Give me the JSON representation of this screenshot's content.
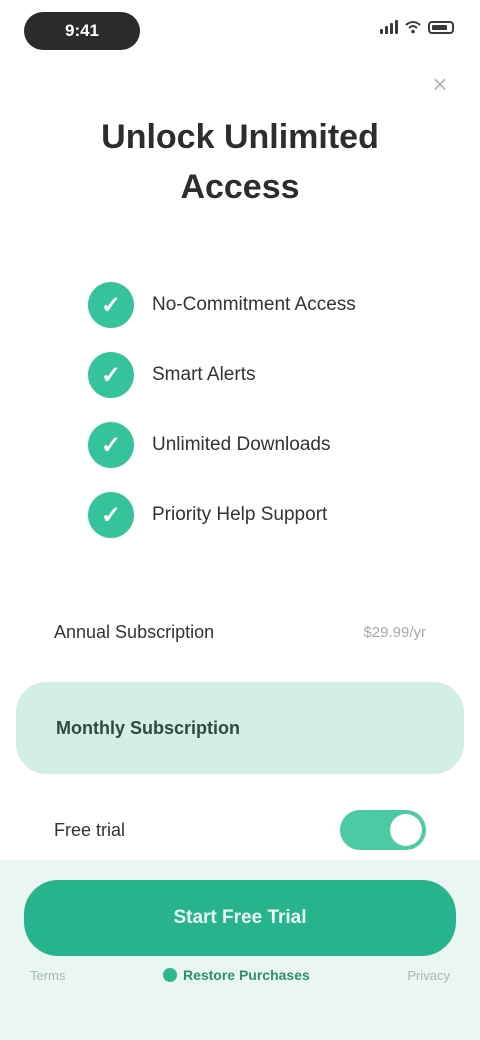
{
  "status_bar": {
    "time": "9:41"
  },
  "close_glyph": "×",
  "title": "Unlock Unlimited Access",
  "features": [
    {
      "icon": "check-icon",
      "label": "No-Commitment Access"
    },
    {
      "icon": "check-icon",
      "label": "Smart Alerts"
    },
    {
      "icon": "check-icon",
      "label": "Unlimited Downloads"
    },
    {
      "icon": "check-icon",
      "label": "Priority Help Support"
    }
  ],
  "plans": {
    "annual": {
      "label": "Annual Subscription",
      "price": "$29.99/yr"
    },
    "monthly": {
      "label": "Monthly Subscription"
    },
    "trial": {
      "label": "Free trial",
      "toggle_on": true
    }
  },
  "cta": {
    "label": "Start Free Trial"
  },
  "footer": {
    "left": "Terms",
    "center": "Restore Purchases",
    "right": "Privacy"
  },
  "colors": {
    "accent": "#27b48c",
    "check": "#34c39a",
    "selected_plan": "#d3eee4"
  }
}
